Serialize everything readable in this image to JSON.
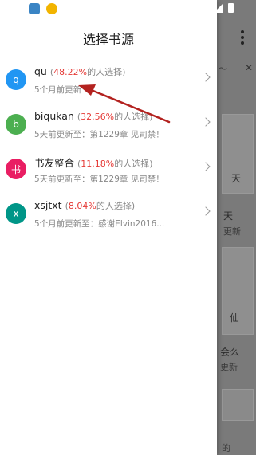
{
  "drawer": {
    "title": "选择书源",
    "items": [
      {
        "initial": "q",
        "color": "#2196f3",
        "name": "qu",
        "percent": "48.22%",
        "suffix": "的人选择)",
        "open": "(",
        "subtitle": "5个月前更新"
      },
      {
        "initial": "b",
        "color": "#4caf50",
        "name": "biqukan",
        "percent": "32.56%",
        "suffix": "的人选择)",
        "open": "(",
        "subtitle": "5天前更新至：第1229章 见司禁！"
      },
      {
        "initial": "书",
        "color": "#e91e63",
        "name": "书友整合",
        "percent": "11.18%",
        "suffix": "的人选择)",
        "open": "(",
        "subtitle": "5天前更新至：第1229章 见司禁！"
      },
      {
        "initial": "x",
        "color": "#009688",
        "name": "xsjtxt",
        "percent": "8.04%",
        "suffix": "的人选择)",
        "open": "(",
        "subtitle": "5个月前更新至：感谢Elvin2016..."
      }
    ]
  },
  "background": {
    "texts": [
      "天",
      "天",
      "更新",
      "仙",
      "会么",
      "更新",
      "的"
    ],
    "close_symbol": "✕",
    "dash": "～"
  },
  "icons": {
    "status_left": [
      "twitter-icon",
      "alarm-icon"
    ],
    "status_right": [
      "signal-icon",
      "battery-icon"
    ],
    "menu": "more-vert-icon",
    "annotation": "red-arrow"
  },
  "colors": {
    "percent": "#e53935",
    "arrow": "#b3221f",
    "drawer_bg": "#ffffff",
    "scrim": "#6f6f6f"
  }
}
